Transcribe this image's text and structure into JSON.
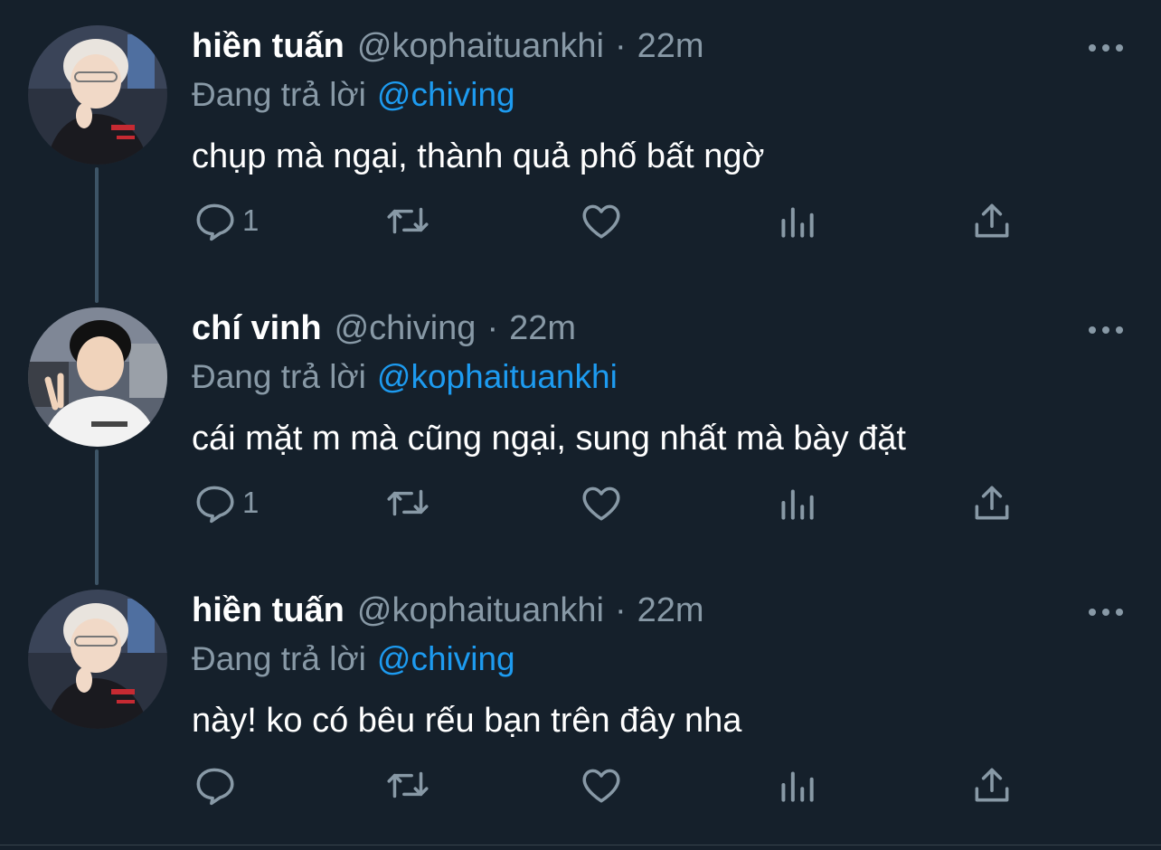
{
  "tweets": [
    {
      "name": "hiền tuấn",
      "handle": "@kophaituankhi",
      "time": "22m",
      "replying_prefix": "Đang trả lời",
      "replying_to": "@chiving",
      "text": "chụp mà ngại, thành quả phố bất ngờ",
      "reply_count": "1",
      "avatar": "avatar-hien-tuan"
    },
    {
      "name": "chí vinh",
      "handle": "@chiving",
      "time": "22m",
      "replying_prefix": "Đang trả lời",
      "replying_to": "@kophaituankhi",
      "text": "cái mặt m mà cũng ngại, sung nhất mà bày đặt",
      "reply_count": "1",
      "avatar": "avatar-chi-vinh"
    },
    {
      "name": "hiền tuấn",
      "handle": "@kophaituankhi",
      "time": "22m",
      "replying_prefix": "Đang trả lời",
      "replying_to": "@chiving",
      "text": "này! ko có bêu rếu bạn trên đây nha",
      "reply_count": "",
      "avatar": "avatar-hien-tuan"
    }
  ],
  "separator": "·",
  "icons": {
    "reply": "reply-icon",
    "retweet": "retweet-icon",
    "like": "heart-icon",
    "analytics": "analytics-icon",
    "share": "share-icon",
    "more": "more-icon"
  },
  "colors": {
    "background": "#15202b",
    "secondary_text": "#8899a6",
    "mention": "#1d9bf0",
    "thread_line": "#3d5466"
  }
}
